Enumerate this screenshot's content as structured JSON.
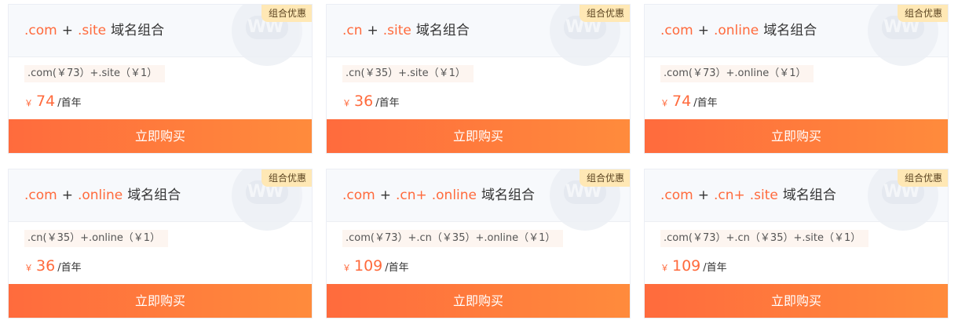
{
  "cards": [
    {
      "badge": "组合优惠",
      "parts": [
        ".com",
        "+",
        ".site"
      ],
      "suffix": "域名组合",
      "detail": ".com(￥73）+.site（￥1）",
      "currency": "￥",
      "price": "74",
      "unit": "/首年",
      "button": "立即购买"
    },
    {
      "badge": "组合优惠",
      "parts": [
        ".cn",
        "+",
        ".site"
      ],
      "suffix": "域名组合",
      "detail": ".cn(￥35）+.site（￥1）",
      "currency": "￥",
      "price": "36",
      "unit": "/首年",
      "button": "立即购买"
    },
    {
      "badge": "组合优惠",
      "parts": [
        ".com",
        "+",
        ".online"
      ],
      "suffix": "域名组合",
      "detail": ".com(￥73）+.online（￥1）",
      "currency": "￥",
      "price": "74",
      "unit": "/首年",
      "button": "立即购买"
    },
    {
      "badge": "组合优惠",
      "parts": [
        ".com",
        "+",
        ".online"
      ],
      "suffix": "域名组合",
      "detail": ".cn(￥35）+.online（￥1）",
      "currency": "￥",
      "price": "36",
      "unit": "/首年",
      "button": "立即购买"
    },
    {
      "badge": "组合优惠",
      "parts": [
        ".com",
        "+",
        ".cn+",
        ".online"
      ],
      "suffix": "域名组合",
      "detail": ".com(￥73）+.cn（￥35）+.online（￥1）",
      "currency": "￥",
      "price": "109",
      "unit": "/首年",
      "button": "立即购买"
    },
    {
      "badge": "组合优惠",
      "parts": [
        ".com",
        "+",
        ".cn+",
        ".site"
      ],
      "suffix": "域名组合",
      "detail": ".com(￥73）+.cn（￥35）+.site（￥1）",
      "currency": "￥",
      "price": "109",
      "unit": "/首年",
      "button": "立即购买"
    }
  ],
  "colors": {
    "accent": "#ff6a3c",
    "button_gradient_start": "#ff6b3d",
    "button_gradient_end": "#ff8b3c",
    "badge_bg": "#ffe8b5",
    "header_bg": "#f7f9fc",
    "detail_bg": "#fdf5f0"
  }
}
